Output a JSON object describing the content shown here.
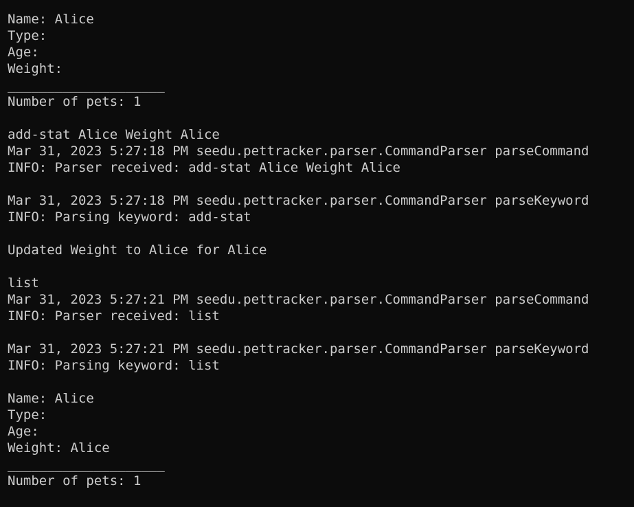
{
  "terminal": {
    "lines": [
      "Name: Alice",
      "Type:",
      "Age:",
      "Weight:",
      "____________________",
      "Number of pets: 1",
      "",
      "add-stat Alice Weight Alice",
      "Mar 31, 2023 5:27:18 PM seedu.pettracker.parser.CommandParser parseCommand",
      "INFO: Parser received: add-stat Alice Weight Alice",
      "",
      "Mar 31, 2023 5:27:18 PM seedu.pettracker.parser.CommandParser parseKeyword",
      "INFO: Parsing keyword: add-stat",
      "",
      "Updated Weight to Alice for Alice",
      "",
      "list",
      "Mar 31, 2023 5:27:21 PM seedu.pettracker.parser.CommandParser parseCommand",
      "INFO: Parser received: list",
      "",
      "Mar 31, 2023 5:27:21 PM seedu.pettracker.parser.CommandParser parseKeyword",
      "INFO: Parsing keyword: list",
      "",
      "Name: Alice",
      "Type:",
      "Age:",
      "Weight: Alice",
      "____________________",
      "Number of pets: 1"
    ],
    "colors": {
      "background": "#0c0c0c",
      "foreground": "#cccccc"
    }
  }
}
